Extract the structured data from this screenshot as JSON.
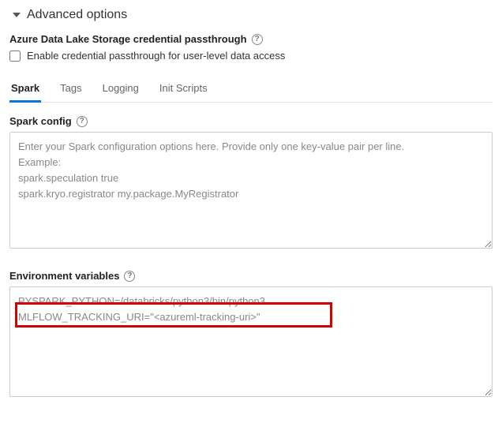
{
  "header": {
    "title": "Advanced options"
  },
  "passthrough": {
    "section_label": "Azure Data Lake Storage credential passthrough",
    "checkbox_label": "Enable credential passthrough for user-level data access",
    "checked": false
  },
  "tabs": [
    {
      "label": "Spark",
      "active": true
    },
    {
      "label": "Tags",
      "active": false
    },
    {
      "label": "Logging",
      "active": false
    },
    {
      "label": "Init Scripts",
      "active": false
    }
  ],
  "spark_config": {
    "label": "Spark config",
    "placeholder": "Enter your Spark configuration options here. Provide only one key-value pair per line.\nExample:\nspark.speculation true\nspark.kryo.registrator my.package.MyRegistrator",
    "value": ""
  },
  "env_vars": {
    "label": "Environment variables",
    "value": "PYSPARK_PYTHON=/databricks/python3/bin/python3\nMLFLOW_TRACKING_URI=\"<azureml-tracking-uri>\""
  }
}
